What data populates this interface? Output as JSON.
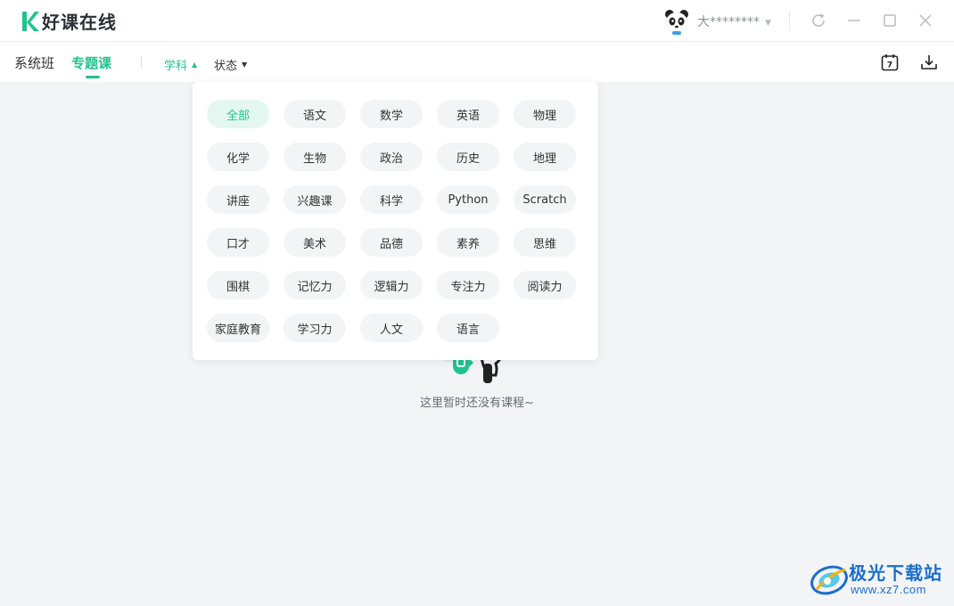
{
  "app": {
    "name": "好课在线",
    "brand_color": "#22c28e"
  },
  "user": {
    "name": "大********"
  },
  "nav": {
    "tabs": [
      {
        "label": "系统班"
      },
      {
        "label": "专题课",
        "active": true
      }
    ],
    "filters": [
      {
        "label": "学科",
        "open": true
      },
      {
        "label": "状态"
      }
    ]
  },
  "subject_dropdown": {
    "selected": "全部",
    "options": [
      "全部",
      "语文",
      "数学",
      "英语",
      "物理",
      "化学",
      "生物",
      "政治",
      "历史",
      "地理",
      "讲座",
      "兴趣课",
      "科学",
      "Python",
      "Scratch",
      "口才",
      "美术",
      "品德",
      "素养",
      "思维",
      "围棋",
      "记忆力",
      "逻辑力",
      "专注力",
      "阅读力",
      "家庭教育",
      "学习力",
      "人文",
      "语言"
    ]
  },
  "empty_state": {
    "message": "这里暂时还没有课程~"
  },
  "calendar_icon_number": "7",
  "watermark": {
    "title": "极光下载站",
    "url": "www.xz7.com"
  }
}
